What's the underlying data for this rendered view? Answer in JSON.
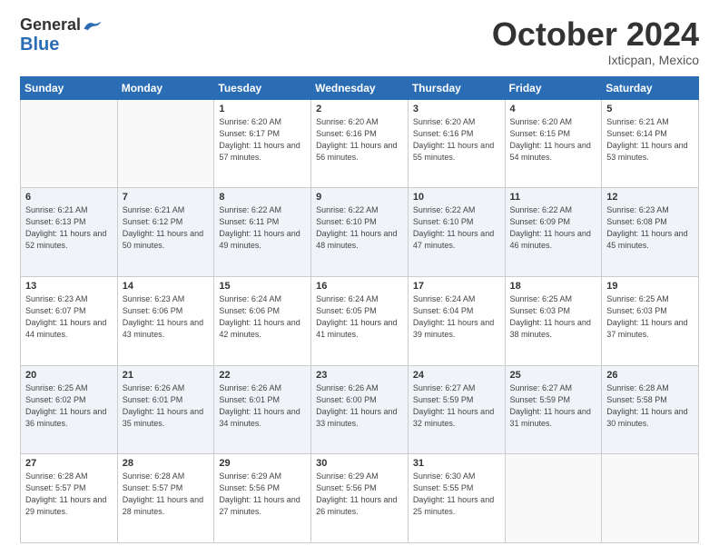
{
  "header": {
    "logo_line1": "General",
    "logo_line2": "Blue",
    "month": "October 2024",
    "location": "Ixticpan, Mexico"
  },
  "weekdays": [
    "Sunday",
    "Monday",
    "Tuesday",
    "Wednesday",
    "Thursday",
    "Friday",
    "Saturday"
  ],
  "weeks": [
    [
      {
        "num": "",
        "info": ""
      },
      {
        "num": "",
        "info": ""
      },
      {
        "num": "1",
        "info": "Sunrise: 6:20 AM\nSunset: 6:17 PM\nDaylight: 11 hours and 57 minutes."
      },
      {
        "num": "2",
        "info": "Sunrise: 6:20 AM\nSunset: 6:16 PM\nDaylight: 11 hours and 56 minutes."
      },
      {
        "num": "3",
        "info": "Sunrise: 6:20 AM\nSunset: 6:16 PM\nDaylight: 11 hours and 55 minutes."
      },
      {
        "num": "4",
        "info": "Sunrise: 6:20 AM\nSunset: 6:15 PM\nDaylight: 11 hours and 54 minutes."
      },
      {
        "num": "5",
        "info": "Sunrise: 6:21 AM\nSunset: 6:14 PM\nDaylight: 11 hours and 53 minutes."
      }
    ],
    [
      {
        "num": "6",
        "info": "Sunrise: 6:21 AM\nSunset: 6:13 PM\nDaylight: 11 hours and 52 minutes."
      },
      {
        "num": "7",
        "info": "Sunrise: 6:21 AM\nSunset: 6:12 PM\nDaylight: 11 hours and 50 minutes."
      },
      {
        "num": "8",
        "info": "Sunrise: 6:22 AM\nSunset: 6:11 PM\nDaylight: 11 hours and 49 minutes."
      },
      {
        "num": "9",
        "info": "Sunrise: 6:22 AM\nSunset: 6:10 PM\nDaylight: 11 hours and 48 minutes."
      },
      {
        "num": "10",
        "info": "Sunrise: 6:22 AM\nSunset: 6:10 PM\nDaylight: 11 hours and 47 minutes."
      },
      {
        "num": "11",
        "info": "Sunrise: 6:22 AM\nSunset: 6:09 PM\nDaylight: 11 hours and 46 minutes."
      },
      {
        "num": "12",
        "info": "Sunrise: 6:23 AM\nSunset: 6:08 PM\nDaylight: 11 hours and 45 minutes."
      }
    ],
    [
      {
        "num": "13",
        "info": "Sunrise: 6:23 AM\nSunset: 6:07 PM\nDaylight: 11 hours and 44 minutes."
      },
      {
        "num": "14",
        "info": "Sunrise: 6:23 AM\nSunset: 6:06 PM\nDaylight: 11 hours and 43 minutes."
      },
      {
        "num": "15",
        "info": "Sunrise: 6:24 AM\nSunset: 6:06 PM\nDaylight: 11 hours and 42 minutes."
      },
      {
        "num": "16",
        "info": "Sunrise: 6:24 AM\nSunset: 6:05 PM\nDaylight: 11 hours and 41 minutes."
      },
      {
        "num": "17",
        "info": "Sunrise: 6:24 AM\nSunset: 6:04 PM\nDaylight: 11 hours and 39 minutes."
      },
      {
        "num": "18",
        "info": "Sunrise: 6:25 AM\nSunset: 6:03 PM\nDaylight: 11 hours and 38 minutes."
      },
      {
        "num": "19",
        "info": "Sunrise: 6:25 AM\nSunset: 6:03 PM\nDaylight: 11 hours and 37 minutes."
      }
    ],
    [
      {
        "num": "20",
        "info": "Sunrise: 6:25 AM\nSunset: 6:02 PM\nDaylight: 11 hours and 36 minutes."
      },
      {
        "num": "21",
        "info": "Sunrise: 6:26 AM\nSunset: 6:01 PM\nDaylight: 11 hours and 35 minutes."
      },
      {
        "num": "22",
        "info": "Sunrise: 6:26 AM\nSunset: 6:01 PM\nDaylight: 11 hours and 34 minutes."
      },
      {
        "num": "23",
        "info": "Sunrise: 6:26 AM\nSunset: 6:00 PM\nDaylight: 11 hours and 33 minutes."
      },
      {
        "num": "24",
        "info": "Sunrise: 6:27 AM\nSunset: 5:59 PM\nDaylight: 11 hours and 32 minutes."
      },
      {
        "num": "25",
        "info": "Sunrise: 6:27 AM\nSunset: 5:59 PM\nDaylight: 11 hours and 31 minutes."
      },
      {
        "num": "26",
        "info": "Sunrise: 6:28 AM\nSunset: 5:58 PM\nDaylight: 11 hours and 30 minutes."
      }
    ],
    [
      {
        "num": "27",
        "info": "Sunrise: 6:28 AM\nSunset: 5:57 PM\nDaylight: 11 hours and 29 minutes."
      },
      {
        "num": "28",
        "info": "Sunrise: 6:28 AM\nSunset: 5:57 PM\nDaylight: 11 hours and 28 minutes."
      },
      {
        "num": "29",
        "info": "Sunrise: 6:29 AM\nSunset: 5:56 PM\nDaylight: 11 hours and 27 minutes."
      },
      {
        "num": "30",
        "info": "Sunrise: 6:29 AM\nSunset: 5:56 PM\nDaylight: 11 hours and 26 minutes."
      },
      {
        "num": "31",
        "info": "Sunrise: 6:30 AM\nSunset: 5:55 PM\nDaylight: 11 hours and 25 minutes."
      },
      {
        "num": "",
        "info": ""
      },
      {
        "num": "",
        "info": ""
      }
    ]
  ]
}
